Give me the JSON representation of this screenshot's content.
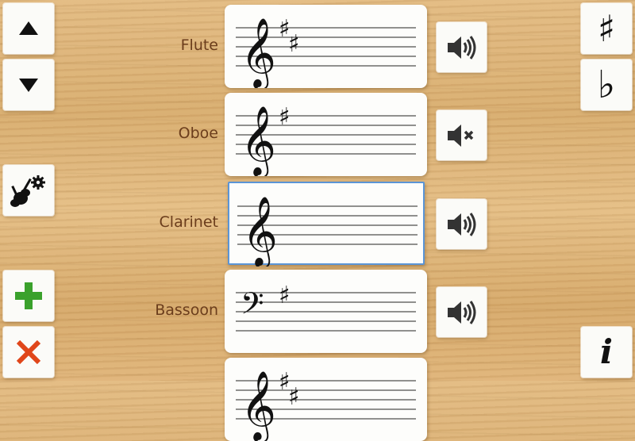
{
  "instruments": [
    {
      "name": "Flute",
      "clef": "treble",
      "accidentals": 2,
      "sound": "on"
    },
    {
      "name": "Oboe",
      "clef": "treble",
      "accidentals": 1,
      "sound": "muted"
    },
    {
      "name": "Clarinet",
      "clef": "treble",
      "accidentals": 0,
      "sound": "on",
      "selected": true
    },
    {
      "name": "Bassoon",
      "clef": "bass",
      "accidentals": 1,
      "sound": "on"
    },
    {
      "name": "",
      "clef": "treble",
      "accidentals": 2,
      "sound": "hidden"
    }
  ],
  "left_toolbar": {
    "up_icon": "arrow-up-icon",
    "down_icon": "arrow-down-icon",
    "instrument_settings_icon": "guitar-gear-icon",
    "add_icon": "plus-icon",
    "delete_icon": "close-icon"
  },
  "right_toolbar": {
    "sharp_label": "♯",
    "flat_label": "♭",
    "info_label": "i"
  },
  "colors": {
    "label": "#6b3d1c",
    "add": "#3aa12c",
    "delete": "#e0461a",
    "selected_border": "#5b95d6"
  }
}
